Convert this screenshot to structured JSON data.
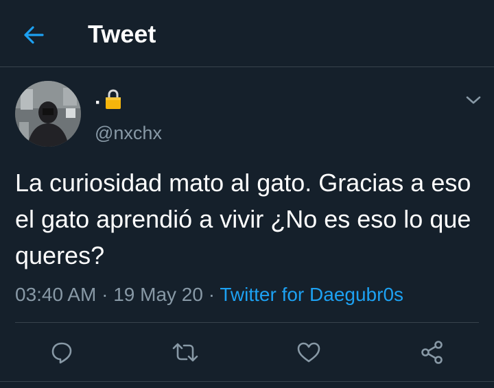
{
  "header": {
    "title": "Tweet",
    "back_icon": "arrow-left-icon"
  },
  "author": {
    "display_name": "·",
    "lock_icon": "lock-icon",
    "username": "@nxchx",
    "avatar": "profile-photo"
  },
  "tweet": {
    "text": "La curiosidad mato al gato. Gracias a eso el gato aprendió a vivir ¿No es eso lo que queres?",
    "time": "03:40 AM",
    "separator": " · ",
    "date": "19 May 20",
    "source": "Twitter for Daegubr0s"
  },
  "actions": [
    "reply-icon",
    "retweet-icon",
    "like-icon",
    "share-icon"
  ],
  "colors": {
    "background": "#15202b",
    "accent": "#1da1f2",
    "secondary_text": "#8899a6",
    "border": "#38444d"
  }
}
